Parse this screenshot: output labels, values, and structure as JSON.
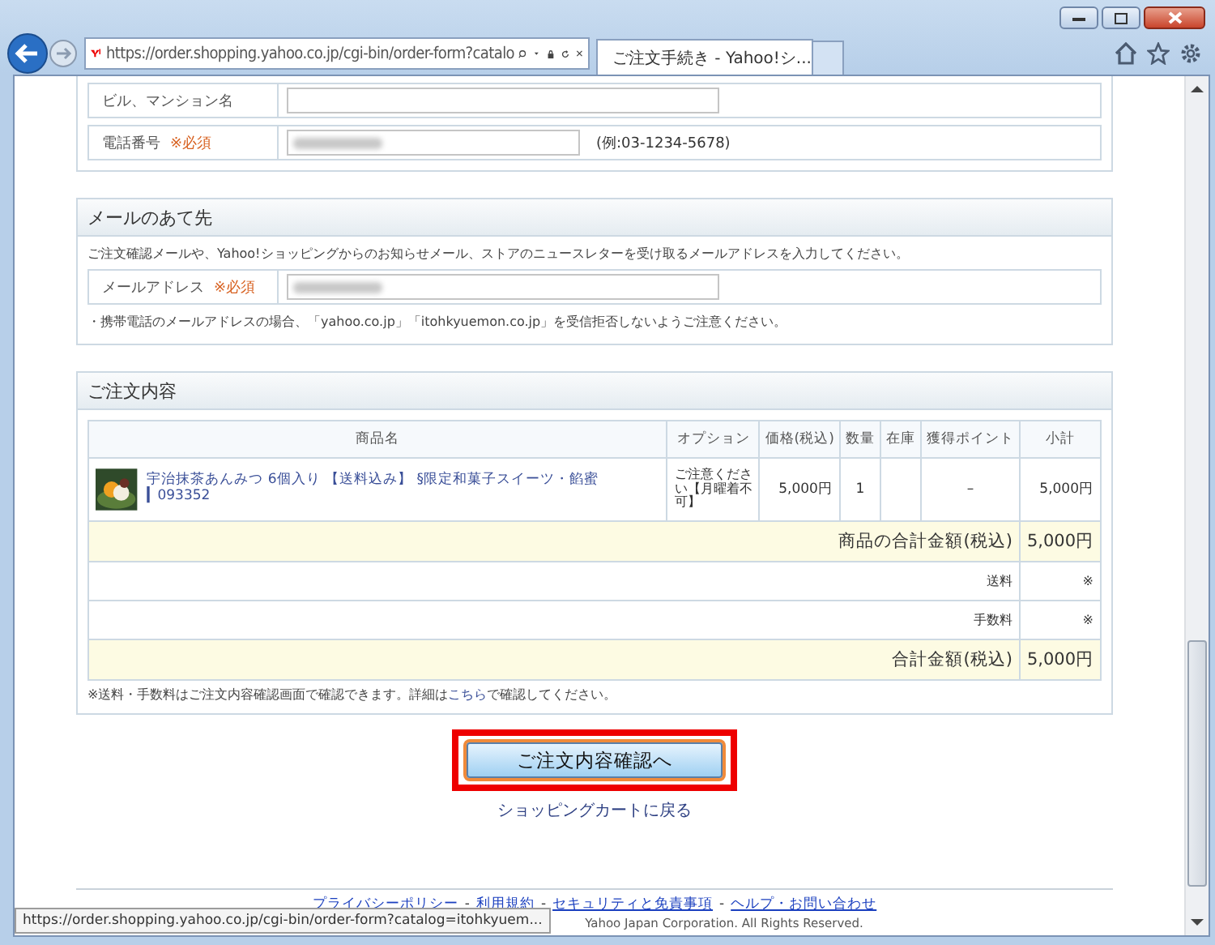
{
  "browser": {
    "url": "https://order.shopping.yahoo.co.jp/cgi-bin/order-form?catalo",
    "tabs": [
      {
        "title": "ご注文手続き - Yahoo!シ...",
        "selected": true
      }
    ]
  },
  "address_section": {
    "rows": [
      {
        "label": "ビル、マンション名"
      },
      {
        "label": "電話番号",
        "required": "※必須",
        "blurred": true,
        "example": "(例:03-1234-5678)"
      }
    ]
  },
  "mail_section": {
    "title": "メールのあて先",
    "description": "ご注文確認メールや、Yahoo!ショッピングからのお知らせメール、ストアのニュースレターを受け取るメールアドレスを入力してください。",
    "rows": [
      {
        "label": "メールアドレス",
        "required": "※必須",
        "blurred": true
      }
    ],
    "note": "・携帯電話のメールアドレスの場合、「yahoo.co.jp」「itohkyuemon.co.jp」を受信拒否しないようご注意ください。"
  },
  "order_section": {
    "title": "ご注文内容",
    "columns": [
      "商品名",
      "オプション",
      "価格(税込)",
      "数量",
      "在庫",
      "獲得ポイント",
      "小計"
    ],
    "items": [
      {
        "name": "宇治抹茶あんみつ 6個入り 【送料込み】 §限定和菓子スイーツ・餡蜜 ▎093352",
        "option": "ご注意ください【月曜着不可】",
        "price": "5,000円",
        "quantity": "1",
        "points": "–",
        "subtotal": "5,000円"
      }
    ],
    "summary_rows": [
      {
        "kind": "total",
        "label": "商品の合計金額(税込)",
        "value": "5,000円"
      },
      {
        "kind": "fee",
        "label": "送料",
        "value": "※"
      },
      {
        "kind": "fee",
        "label": "手数料",
        "value": "※"
      },
      {
        "kind": "total",
        "label": "合計金額(税込)",
        "value": "5,000円"
      }
    ],
    "note_before": "※送料・手数料はご注文内容確認画面で確認できます。詳細は",
    "note_link": "こちら",
    "note_after": "で確認してください。"
  },
  "confirm_button": "ご注文内容確認へ",
  "back_link": "ショッピングカートに戻る",
  "footer": {
    "separator": "-",
    "links": [
      "プライバシーポリシー",
      "利用規約",
      "セキュリティと免責事項",
      "ヘルプ・お問い合わせ"
    ],
    "copyright": "Yahoo Japan Corporation. All Rights Reserved."
  },
  "status_tooltip": "https://order.shopping.yahoo.co.jp/cgi-bin/order-form?catalog=itohkyuem..."
}
